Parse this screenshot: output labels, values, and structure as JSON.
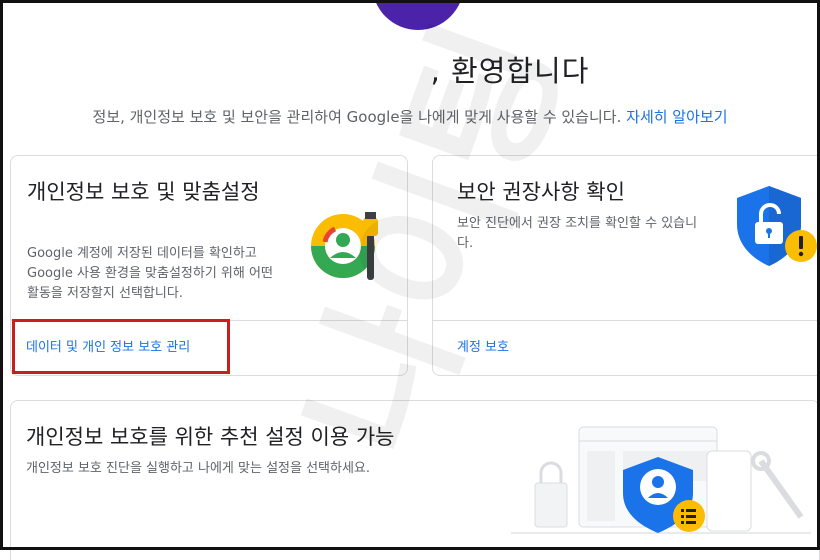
{
  "header": {
    "welcome": ", 환영합니다",
    "intro_text": "정보, 개인정보 보호 및 보안을 관리하여 Google을 나에게 맞게 사용할 수 있습니다.",
    "learn_more": "자세히 알아보기"
  },
  "privacy_card": {
    "title": "개인정보 보호 및 맞춤설정",
    "description": "Google 계정에 저장된 데이터를 확인하고 Google 사용 환경을 맞춤설정하기 위해 어떤 활동을 저장할지 선택합니다.",
    "link": "데이터 및 개인 정보 보호 관리"
  },
  "security_card": {
    "title": "보안 권장사항 확인",
    "description": "보안 진단에서 권장 조치를 확인할 수 있습니다.",
    "link": "계정 보호"
  },
  "recommend_card": {
    "title": "개인정보 보호를 위한 추천 설정 이용 가능",
    "description": "개인정보 보호 진단을 실행하고 나에게 맞는 설정을 선택하세요."
  },
  "watermark": "나이팅",
  "colors": {
    "accent": "#1a73e8",
    "highlight": "#c81f1f",
    "avatar": "#4a23a8"
  },
  "icons": [
    "privacy-palette-icon",
    "security-shield-lock-icon",
    "warning-icon",
    "privacy-checkup-illustration"
  ]
}
